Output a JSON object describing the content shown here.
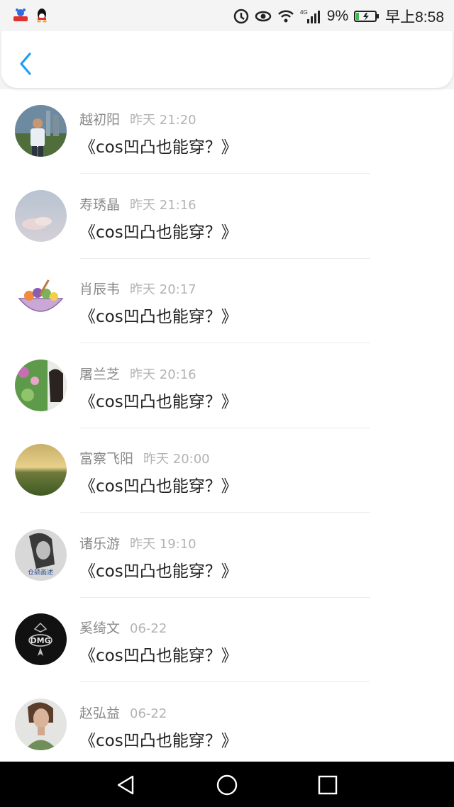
{
  "status_bar": {
    "battery_percent": "9%",
    "time": "早上8:58",
    "network": "4G",
    "icons": [
      "baidu-app-icon",
      "qq-icon",
      "data-saver-icon",
      "eye-icon",
      "wifi-icon",
      "signal-icon",
      "battery-charging-icon"
    ]
  },
  "header": {
    "back_icon": "chevron-left-icon",
    "accent_color": "#1e9ff2"
  },
  "items": [
    {
      "name": "越初阳",
      "time": "昨天 21:20",
      "message": "《cos凹凸也能穿？》",
      "avatar": "man-outdoor"
    },
    {
      "name": "寿琇晶",
      "time": "昨天 21:16",
      "message": "《cos凹凸也能穿？》",
      "avatar": "sky-clouds"
    },
    {
      "name": "肖辰韦",
      "time": "昨天 20:17",
      "message": "《cos凹凸也能穿？》",
      "avatar": "food-bowl"
    },
    {
      "name": "屠兰芝",
      "time": "昨天 20:16",
      "message": "《cos凹凸也能穿？》",
      "avatar": "girl-flowers"
    },
    {
      "name": "富察飞阳",
      "time": "昨天 20:00",
      "message": "《cos凹凸也能穿？》",
      "avatar": "sunset-field"
    },
    {
      "name": "诸乐游",
      "time": "昨天 19:10",
      "message": "《cos凹凸也能穿？》",
      "avatar": "bw-girl"
    },
    {
      "name": "奚绮文",
      "time": "06-22",
      "message": "《cos凹凸也能穿？》",
      "avatar": "dmg-logo"
    },
    {
      "name": "赵弘益",
      "time": "06-22",
      "message": "《cos凹凸也能穿？》",
      "avatar": "woman-portrait"
    }
  ],
  "avatar_logo_text": {
    "dmg": "DMG",
    "bw": "仓颉画述"
  },
  "nav_bar": {
    "icons": [
      "back-triangle-icon",
      "home-circle-icon",
      "recents-square-icon"
    ]
  }
}
